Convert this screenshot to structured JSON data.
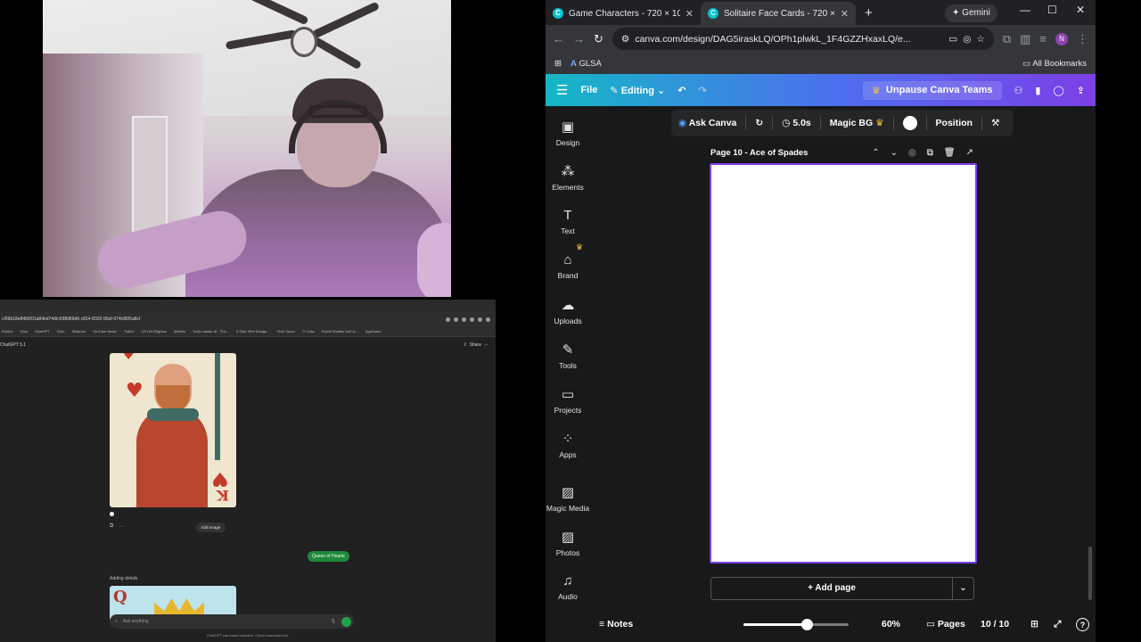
{
  "gpt": {
    "url": "c/69b18e84bf201a84ed74d/c698d69d6-c814-8332-95af-374c8f26a8cf",
    "bookmarks": [
      "Roblox",
      "Grok",
      "ChatGPT",
      "Gem",
      "Skidpost",
      "YouTube Music",
      "Twitch",
      "US Life Pilgrims",
      "Mobbin",
      "Tools master AI - The...",
      "5 Step Vibe Design...",
      "Tech Touch",
      "TI Links",
      "Social Studies Unit la...",
      "AppSumo"
    ],
    "model": "ChatGPT 5.1",
    "share": "Share",
    "edit_image": "Edit image",
    "user_bubble": "Queen of Hearts",
    "status": "Adding details",
    "composer_placeholder": "Ask anything",
    "footer": "ChatGPT can make mistakes. Check important info.",
    "card_index": "K",
    "card2_index": "Q"
  },
  "chrome": {
    "tabs": [
      {
        "label": "Game Characters - 720 × 1080"
      },
      {
        "label": "Solitaire Face Cards - 720 × 10"
      }
    ],
    "gemini": "Gemini",
    "url": "canva.com/design/DAG5iraskLQ/OPh1plwkL_1F4GZZHxaxLQ/e...",
    "bookmark_folder": "GLSA",
    "all_bookmarks": "All Bookmarks",
    "avatar": "N"
  },
  "canva": {
    "file": "File",
    "editing": "Editing",
    "unpause": "Unpause Canva Teams",
    "ask_canva": "Ask Canva",
    "duration": "5.0s",
    "magic_bg": "Magic BG",
    "position": "Position",
    "page_title": "Page 10 - Ace of Spades",
    "add_page": "+ Add page",
    "notes": "Notes",
    "zoom": "60%",
    "zoom_level": 0.6,
    "pages": "Pages",
    "page_count": "10 / 10",
    "sidebar": {
      "design": "Design",
      "elements": "Elements",
      "text": "Text",
      "brand": "Brand",
      "uploads": "Uploads",
      "tools": "Tools",
      "projects": "Projects",
      "apps": "Apps",
      "magic_media": "Magic Media",
      "photos": "Photos",
      "audio": "Audio"
    }
  }
}
